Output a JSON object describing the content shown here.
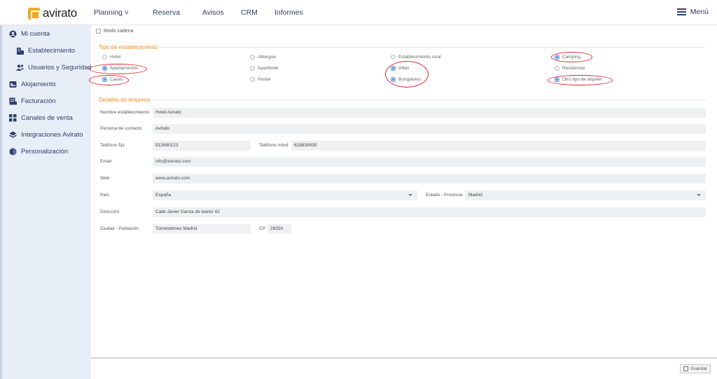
{
  "header": {
    "logo_text": "avirato",
    "nav": [
      "Planning ˅",
      "Reserva",
      "Avisos",
      "CRM",
      "Informes"
    ],
    "menu_label": "Menú"
  },
  "sidebar": {
    "items": [
      {
        "label": "Mi cuenta",
        "icon": "user-circle-icon"
      },
      {
        "label": "Establecimiento",
        "icon": "building-icon"
      },
      {
        "label": "Usuarios y Seguridad",
        "icon": "users-icon"
      },
      {
        "label": "Alojamiento",
        "icon": "bed-icon"
      },
      {
        "label": "Facturación",
        "icon": "invoice-icon"
      },
      {
        "label": "Canales de venta",
        "icon": "grid-icon"
      },
      {
        "label": "Integraciones Avirato",
        "icon": "layers-icon"
      },
      {
        "label": "Personalización",
        "icon": "palette-icon"
      }
    ]
  },
  "form": {
    "modo_cadena": "Modo cadena",
    "tipo_title": "Tipo de establecimiento",
    "tipos": [
      {
        "label": "Hotel",
        "selected": false
      },
      {
        "label": "Albergue",
        "selected": false
      },
      {
        "label": "Establecimiento rural",
        "selected": false
      },
      {
        "label": "Camping",
        "selected": true
      },
      {
        "label": "Apartamentos",
        "selected": true
      },
      {
        "label": "Aparthotel",
        "selected": false
      },
      {
        "label": "Villas",
        "selected": true
      },
      {
        "label": "Residencia",
        "selected": false
      },
      {
        "label": "Casas",
        "selected": true
      },
      {
        "label": "Hostel",
        "selected": false
      },
      {
        "label": "Bungalows",
        "selected": true
      },
      {
        "label": "Otro tipo de alquiler",
        "selected": true
      }
    ],
    "detalles_title": "Detalles de empresa",
    "fields": {
      "nombre": {
        "label": "Nombre establecimiento",
        "value": "Hotel Avirato"
      },
      "persona": {
        "label": "Persona de contacto",
        "value": "Avirato"
      },
      "tel_fijo": {
        "label": "Teléfono fijo",
        "value": "912690123"
      },
      "tel_movil": {
        "label": "Teléfono móvil",
        "value": "628839039"
      },
      "email": {
        "label": "Email",
        "value": "info@avirato.com"
      },
      "web": {
        "label": "Web",
        "value": "www.avirato.com"
      },
      "pais": {
        "label": "País",
        "value": "España"
      },
      "estado": {
        "label": "Estado - Provincia",
        "value": "Madrid"
      },
      "direccion": {
        "label": "Dirección",
        "value": "Calle Javier Garcia de leaniz 42"
      },
      "ciudad": {
        "label": "Ciudad - Población",
        "value": "Torrelodones Madrid"
      },
      "cp": {
        "label": "CP",
        "value": "28250"
      }
    },
    "save_label": "Guardar"
  },
  "colors": {
    "accent": "#f08c1e",
    "nav": "#2d3e6b",
    "highlight": "#e0262d",
    "radio": "#3a7bd5"
  }
}
